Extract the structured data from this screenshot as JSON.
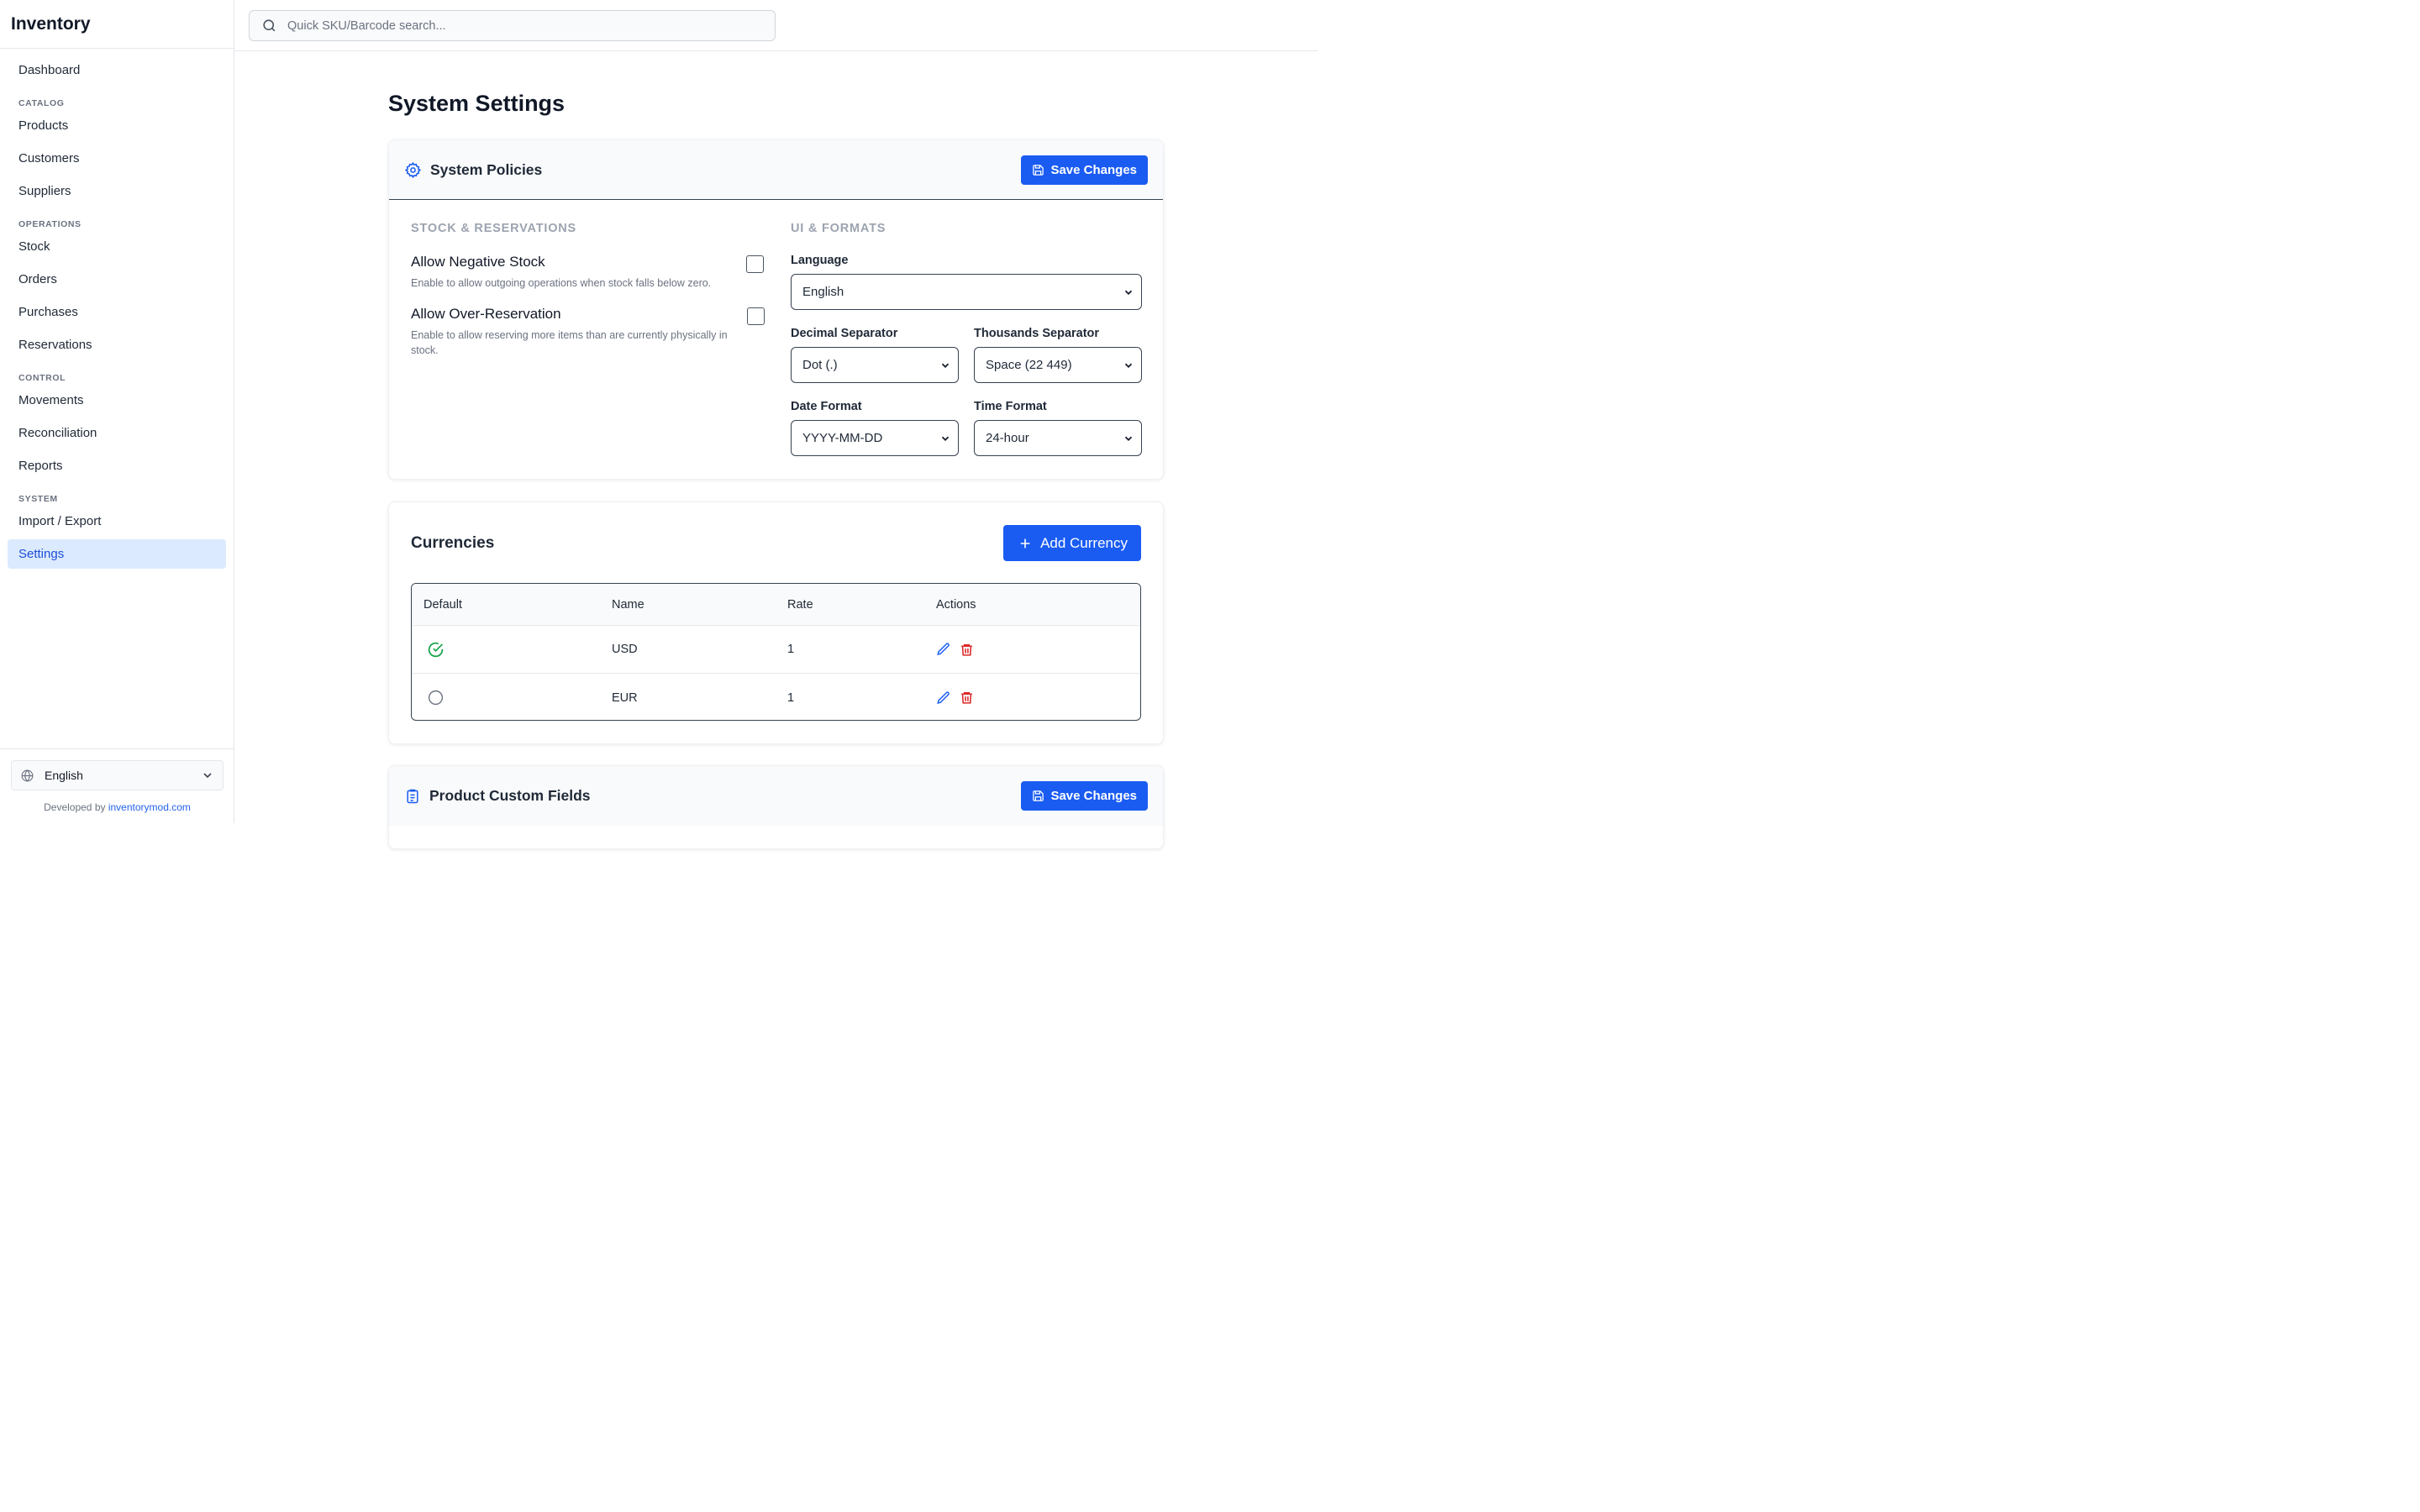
{
  "app": {
    "title": "Inventory"
  },
  "search": {
    "placeholder": "Quick SKU/Barcode search..."
  },
  "sidebar": {
    "dashboard": "Dashboard",
    "sections": {
      "catalog": "CATALOG",
      "operations": "OPERATIONS",
      "control": "CONTROL",
      "system": "SYSTEM"
    },
    "items": {
      "products": "Products",
      "customers": "Customers",
      "suppliers": "Suppliers",
      "stock": "Stock",
      "orders": "Orders",
      "purchases": "Purchases",
      "reservations": "Reservations",
      "movements": "Movements",
      "reconciliation": "Reconciliation",
      "reports": "Reports",
      "import_export": "Import / Export",
      "settings": "Settings"
    },
    "active": "settings",
    "footer": {
      "language": "English",
      "developed_by": "Developed by",
      "developer_link": "inventorymod.com"
    }
  },
  "page": {
    "title": "System Settings"
  },
  "policies": {
    "title": "System Policies",
    "save_label": "Save Changes",
    "stock_section": "STOCK & RESERVATIONS",
    "ui_section": "UI & FORMATS",
    "toggles": [
      {
        "title": "Allow Negative Stock",
        "description": "Enable to allow outgoing operations when stock falls below zero.",
        "checked": false
      },
      {
        "title": "Allow Over-Reservation",
        "description": "Enable to allow reserving more items than are currently physically in stock.",
        "checked": false
      }
    ],
    "language": {
      "label": "Language",
      "value": "English"
    },
    "decimal_separator": {
      "label": "Decimal Separator",
      "value": "Dot (.)"
    },
    "thousands_separator": {
      "label": "Thousands Separator",
      "value": "Space (22 449)"
    },
    "date_format": {
      "label": "Date Format",
      "value": "YYYY-MM-DD"
    },
    "time_format": {
      "label": "Time Format",
      "value": "24-hour"
    }
  },
  "currencies": {
    "title": "Currencies",
    "add_label": "Add Currency",
    "columns": [
      "Default",
      "Name",
      "Rate",
      "Actions"
    ],
    "rows": [
      {
        "default": true,
        "name": "USD",
        "rate": "1"
      },
      {
        "default": false,
        "name": "EUR",
        "rate": "1"
      }
    ]
  },
  "custom_fields": {
    "title": "Product Custom Fields",
    "save_label": "Save Changes"
  },
  "colors": {
    "primary": "#1a5cf2",
    "active_bg": "#dbeafe",
    "success": "#16a34a",
    "danger": "#dc2626"
  },
  "icons": {
    "search": "search-icon",
    "gear": "gear-icon",
    "save": "floppy-disk-icon",
    "plus": "plus-icon",
    "check_circle": "check-circle-icon",
    "empty_circle": "circle-icon",
    "edit": "pencil-icon",
    "delete": "trash-icon",
    "globe": "globe-icon",
    "chevron": "chevron-down-icon",
    "clipboard": "clipboard-icon"
  }
}
